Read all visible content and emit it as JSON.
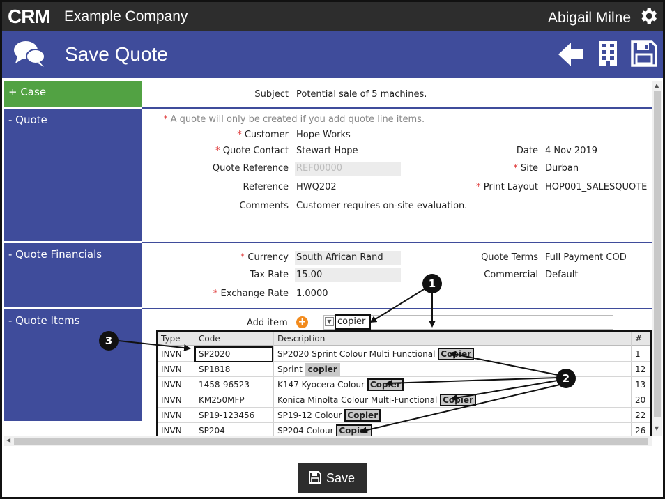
{
  "app": {
    "logo": "CRM",
    "company": "Example Company",
    "user": "Abigail Milne",
    "page_title": "Save Quote"
  },
  "sections": {
    "case": "+ Case",
    "quote": "- Quote",
    "financials": "- Quote Financials",
    "items": "- Quote Items"
  },
  "case": {
    "subject_label": "Subject",
    "subject_value": "Potential sale of 5 machines."
  },
  "quote": {
    "note": "A quote will only be created if you add quote line items.",
    "customer_label": "Customer",
    "customer_value": "Hope Works",
    "contact_label": "Quote Contact",
    "contact_value": "Stewart Hope",
    "qref_label": "Quote Reference",
    "qref_value": "REF00000",
    "ref_label": "Reference",
    "ref_value": "HWQ202",
    "comments_label": "Comments",
    "comments_value": "Customer requires on-site evaluation.",
    "date_label": "Date",
    "date_value": "4 Nov 2019",
    "site_label": "Site",
    "site_value": "Durban",
    "layout_label": "Print Layout",
    "layout_value": "HOP001_SALESQUOTE"
  },
  "financials": {
    "currency_label": "Currency",
    "currency_value": "South African Rand",
    "tax_label": "Tax Rate",
    "tax_value": "15.00",
    "exch_label": "Exchange Rate",
    "exch_value": "1.0000",
    "terms_label": "Quote Terms",
    "terms_value": "Full Payment COD",
    "commercial_label": "Commercial",
    "commercial_value": "Default"
  },
  "items": {
    "add_label": "Add item",
    "query": "copier",
    "headers": {
      "type": "Type",
      "code": "Code",
      "desc": "Description",
      "num": "#"
    },
    "rows": [
      {
        "type": "INVN",
        "code": "SP2020",
        "desc": "SP2020 Sprint Colour Multi Functional ",
        "match": "Copier",
        "num": "1"
      },
      {
        "type": "INVN",
        "code": "SP1818",
        "desc": "Sprint ",
        "match": "copier",
        "num": "12"
      },
      {
        "type": "INVN",
        "code": "1458-96523",
        "desc": "K147 Kyocera Colour ",
        "match": "Copier",
        "num": "13"
      },
      {
        "type": "INVN",
        "code": "KM250MFP",
        "desc": "Konica Minolta Colour Multi-Functional ",
        "match": "Copier",
        "num": "20"
      },
      {
        "type": "INVN",
        "code": "SP19-123456",
        "desc": "SP19-12 Colour ",
        "match": "Copier",
        "num": "22"
      },
      {
        "type": "INVN",
        "code": "SP204",
        "desc": "SP204 Colour ",
        "match": "Copier",
        "num": "26"
      }
    ]
  },
  "callouts": {
    "one": "1",
    "two": "2",
    "three": "3"
  },
  "footer": {
    "save_label": "Save"
  },
  "colors": {
    "topbar": "#2d2d2d",
    "brand_blue": "#3f4c9b",
    "case_green": "#52a243",
    "accent_orange": "#f28b1d",
    "required_red": "#e03a3a"
  }
}
